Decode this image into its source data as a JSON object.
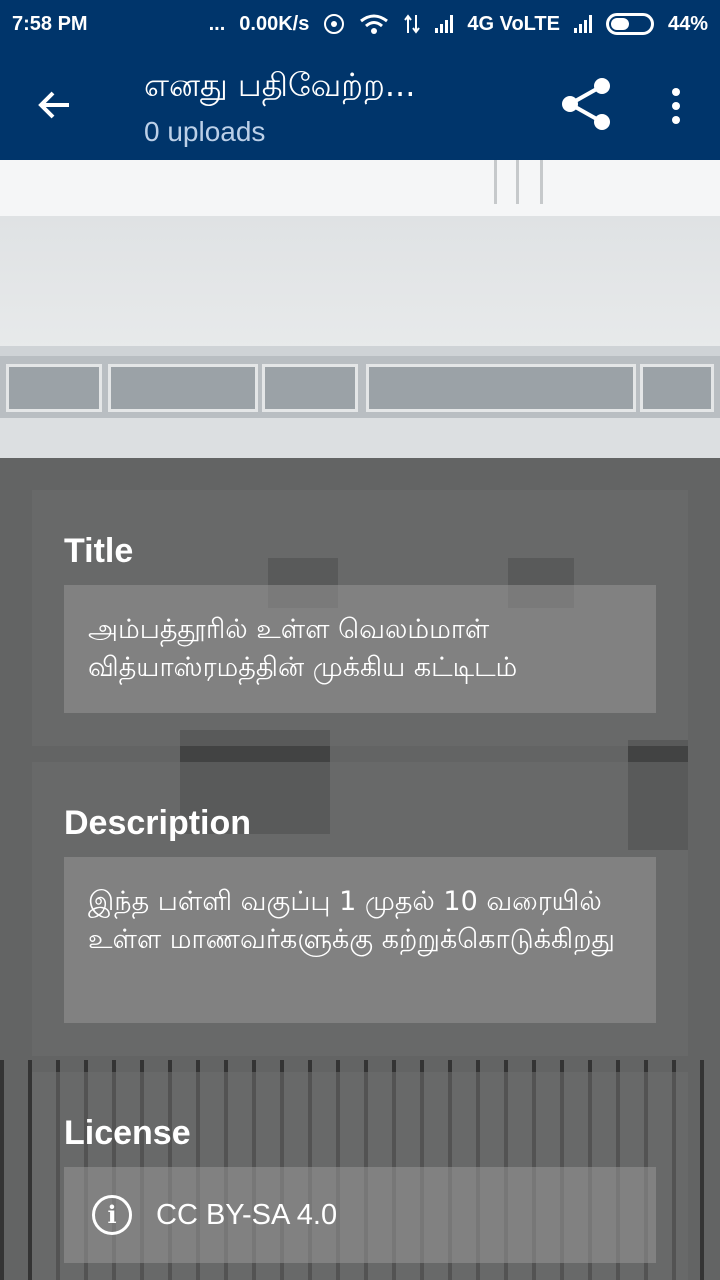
{
  "status_bar": {
    "time": "7:58 PM",
    "dots": "...",
    "speed": "0.00K/s",
    "network": "4G VoLTE",
    "battery": "44%"
  },
  "app_bar": {
    "title": "எனது பதிவேற்ற...",
    "subtitle": "0 uploads",
    "icons": [
      "back-arrow-icon",
      "share-icon",
      "more-vert-icon"
    ]
  },
  "details": {
    "title_label": "Title",
    "title_value": "அம்பத்தூரில் உள்ள வெலம்மாள் வித்யாஸ்ரமத்தின் முக்கிய கட்டிடம்",
    "description_label": "Description",
    "description_value": "இந்த பள்ளி வகுப்பு 1 முதல் 10 வரையில் உள்ள மாணவர்களுக்கு கற்றுக்கொடுக்கிறது",
    "license_label": "License",
    "license_value": "CC BY-SA 4.0"
  },
  "colors": {
    "app_bar": "#00356b",
    "text": "#ffffff"
  }
}
